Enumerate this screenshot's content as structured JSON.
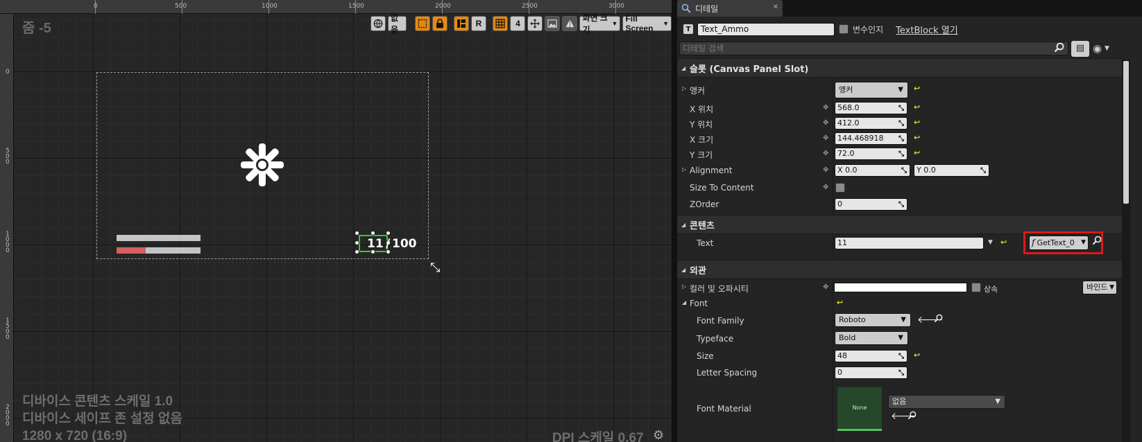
{
  "designer": {
    "zoom_label": "줌 -5",
    "ruler_top": [
      "0",
      "500",
      "1000",
      "1500",
      "2000",
      "2500",
      "3000"
    ],
    "ruler_left": [
      "0",
      "500",
      "1000",
      "1500",
      "2000"
    ],
    "toolbar": {
      "none_label": "없음",
      "r_label": "R",
      "grid_snap_value": "4",
      "screen_size_label": "화면 크기",
      "fill_screen_label": "Fill Screen"
    },
    "widget": {
      "ammo_current": "11",
      "ammo_slash": "/",
      "ammo_max": "100",
      "health_bar_fill": 0.35
    },
    "bottom_info": {
      "line1": "디바이스 콘텐츠 스케일 1.0",
      "line2": "디바이스 세이프 존 설정 없음",
      "line3": "1280 x 720 (16:9)"
    },
    "dpi_label": "DPI 스케일 0.67"
  },
  "details": {
    "tab_title": "디테일",
    "widget_name": "Text_Ammo",
    "is_variable_label": "변수인지",
    "open_textblock_label": "TextBlock 열기",
    "search_placeholder": "디테일 검색",
    "sections": {
      "slot": "슬롯 (Canvas Panel Slot)",
      "content": "콘텐츠",
      "appearance": "외관"
    },
    "slot": {
      "anchor_label": "앵커",
      "anchor_value": "앵커",
      "pos_x_label": "X 위치",
      "pos_x": "568.0",
      "pos_y_label": "Y 위치",
      "pos_y": "412.0",
      "size_x_label": "X 크기",
      "size_x": "144.468918",
      "size_y_label": "Y 크기",
      "size_y": "72.0",
      "alignment_label": "Alignment",
      "alignment_x": "X  0.0",
      "alignment_y": "Y  0.0",
      "size_to_content_label": "Size To Content",
      "zorder_label": "ZOrder",
      "zorder": "0"
    },
    "content": {
      "text_label": "Text",
      "text_value": "11",
      "binding_value": "GetText_0"
    },
    "appearance": {
      "color_label": "컬러 및 오파시티",
      "inherit_label": "상속",
      "bind_label": "바인드",
      "font_label": "Font",
      "font_family_label": "Font Family",
      "font_family": "Roboto",
      "typeface_label": "Typeface",
      "typeface": "Bold",
      "size_label": "Size",
      "size": "48",
      "letter_spacing_label": "Letter Spacing",
      "letter_spacing": "0",
      "font_material_label": "Font Material",
      "font_material_thumb": "None",
      "font_material_value": "없음"
    },
    "colors": {
      "accent_orange": "#e48a12",
      "selection_green": "#24d424",
      "highlight_red": "#e01818",
      "reset_yellow": "#e0d820"
    }
  }
}
